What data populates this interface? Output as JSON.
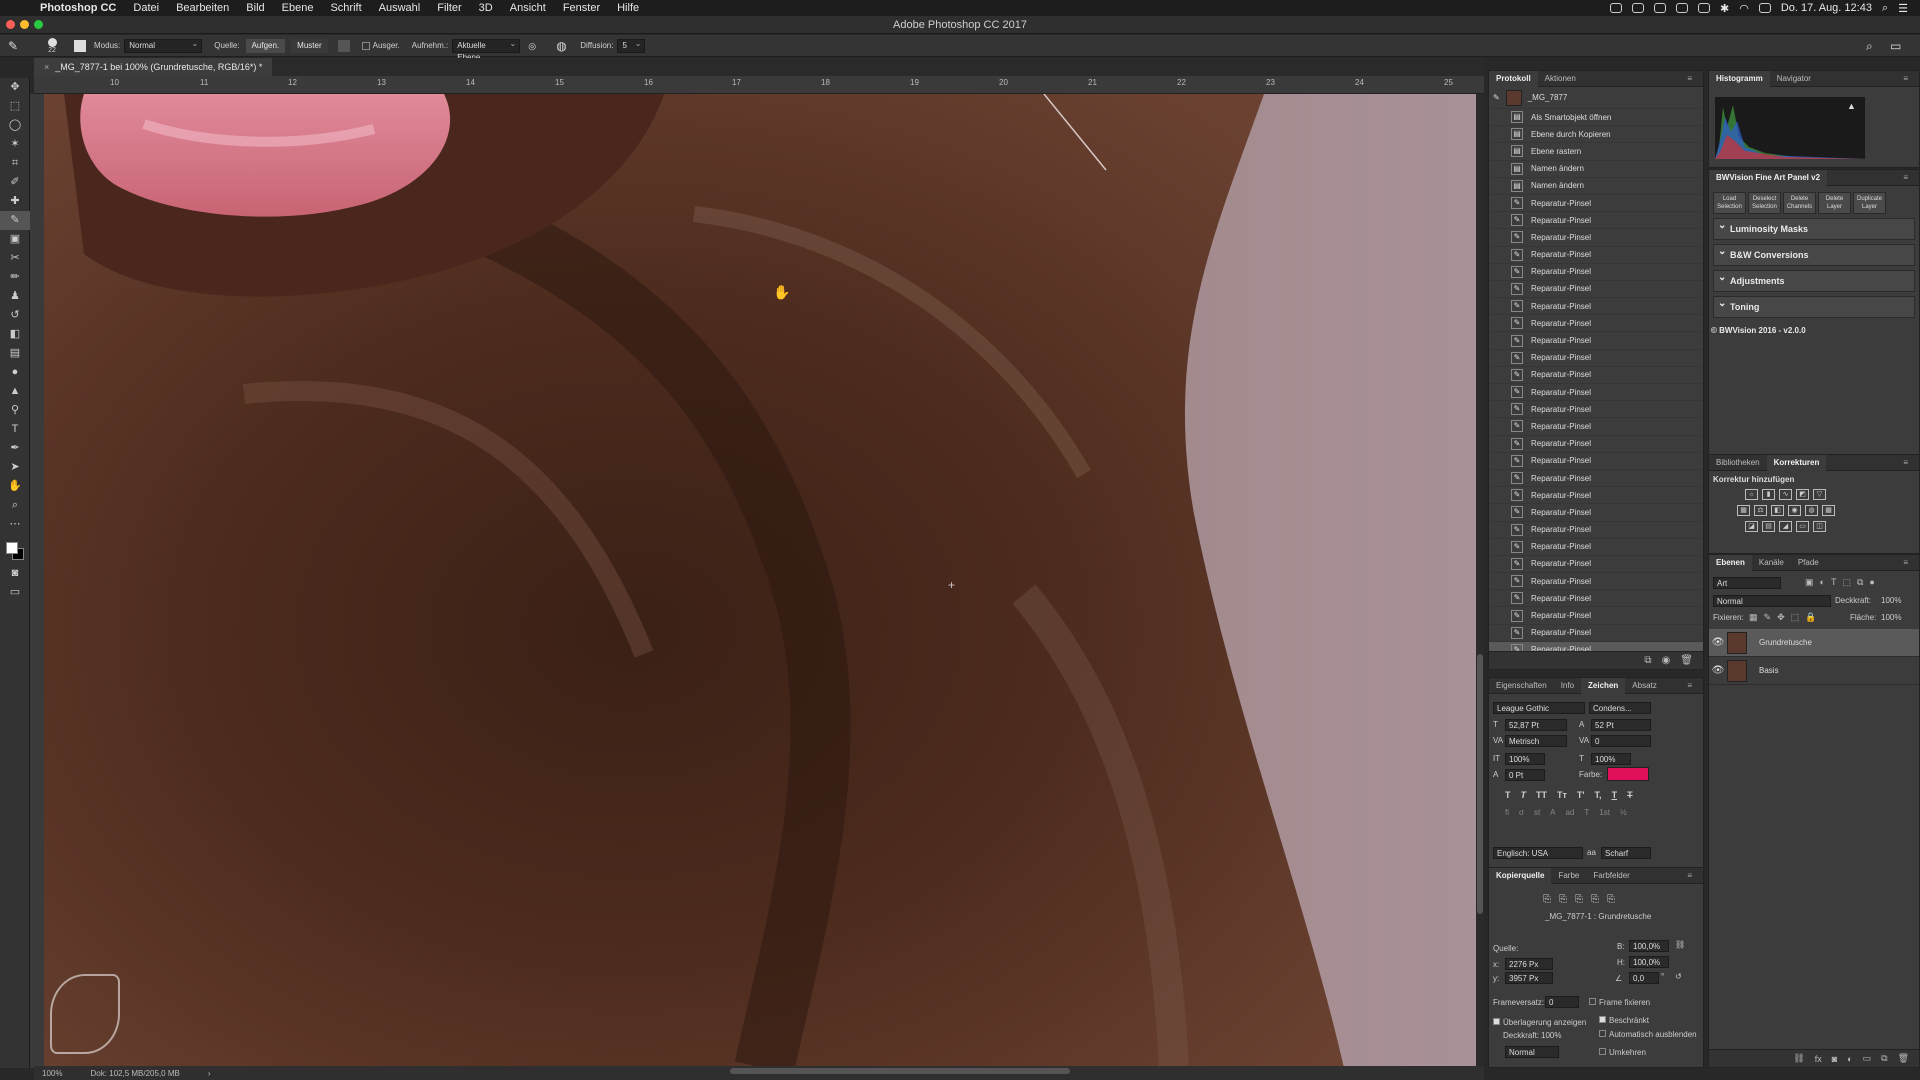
{
  "menubar": {
    "app": "Photoshop CC",
    "items": [
      "Datei",
      "Bearbeiten",
      "Bild",
      "Ebene",
      "Schrift",
      "Auswahl",
      "Filter",
      "3D",
      "Ansicht",
      "Fenster",
      "Hilfe"
    ],
    "clock": "Do. 17. Aug. 12:43"
  },
  "window": {
    "title": "Adobe Photoshop CC 2017"
  },
  "options": {
    "brush_size": "22",
    "modus_label": "Modus:",
    "modus_value": "Normal",
    "quelle_label": "Quelle:",
    "aufgen_label": "Aufgen.",
    "muster_label": "Muster",
    "ausger_label": "Ausger.",
    "aufnehm_label": "Aufnehm.:",
    "aufnehm_value": "Aktuelle Ebene",
    "diffusion_label": "Diffusion:",
    "diffusion_value": "5"
  },
  "document": {
    "tab": "_MG_7877-1 bei 100% (Grundretusche, RGB/16*) *",
    "zoom": "100%",
    "doc_info": "Dok: 102,5 MB/205,0 MB"
  },
  "ruler": {
    "ticks": [
      "10",
      "11",
      "12",
      "13",
      "14",
      "15",
      "16",
      "17",
      "18",
      "19",
      "20",
      "21",
      "22",
      "23",
      "24",
      "25"
    ]
  },
  "tools": [
    "move",
    "marquee",
    "lasso",
    "magic-wand",
    "crop",
    "eyedropper",
    "healing",
    "brush",
    "stamp",
    "history-brush",
    "eraser",
    "gradient",
    "blur",
    "dodge",
    "pen",
    "type",
    "path-select",
    "shape",
    "hand",
    "zoom",
    "more"
  ],
  "history": {
    "tabs": [
      "Protokoll",
      "Aktionen"
    ],
    "snapshot": "_MG_7877",
    "items": [
      "Als Smartobjekt öffnen",
      "Ebene durch Kopieren",
      "Ebene rastern",
      "Namen ändern",
      "Namen ändern",
      "Reparatur-Pinsel",
      "Reparatur-Pinsel",
      "Reparatur-Pinsel",
      "Reparatur-Pinsel",
      "Reparatur-Pinsel",
      "Reparatur-Pinsel",
      "Reparatur-Pinsel",
      "Reparatur-Pinsel",
      "Reparatur-Pinsel",
      "Reparatur-Pinsel",
      "Reparatur-Pinsel",
      "Reparatur-Pinsel",
      "Reparatur-Pinsel",
      "Reparatur-Pinsel",
      "Reparatur-Pinsel",
      "Reparatur-Pinsel",
      "Reparatur-Pinsel",
      "Reparatur-Pinsel",
      "Reparatur-Pinsel",
      "Reparatur-Pinsel",
      "Reparatur-Pinsel",
      "Reparatur-Pinsel",
      "Reparatur-Pinsel",
      "Reparatur-Pinsel",
      "Reparatur-Pinsel",
      "Reparatur-Pinsel",
      "Reparatur-Pinsel"
    ]
  },
  "character": {
    "tabs": [
      "Eigenschaften",
      "Info",
      "Zeichen",
      "Absatz"
    ],
    "font": "League Gothic",
    "style": "Condens...",
    "size": "52,87 Pt",
    "leading": "52 Pt",
    "kerning": "Metrisch",
    "tracking": "0",
    "vscale": "100%",
    "hscale": "100%",
    "baseline": "0 Pt",
    "farbe_label": "Farbe:",
    "farbe": "#e0105a",
    "style_buttons": [
      "T",
      "T",
      "TT",
      "Tт",
      "T'",
      "T,",
      "T",
      "T"
    ],
    "ot_buttons": [
      "fi",
      "σ",
      "st",
      "A",
      "ad",
      "T",
      "1st",
      "½"
    ],
    "language": "Englisch: USA",
    "aa_label": "aa",
    "aa": "Scharf"
  },
  "clone": {
    "tabs": [
      "Kopierquelle",
      "Farbe",
      "Farbfelder"
    ],
    "source_name": "_MG_7877-1 : Grundretusche",
    "quelle_label": "Quelle:",
    "x": "2276 Px",
    "y": "3957 Px",
    "w": "100,0%",
    "h": "100,0%",
    "angle": "0,0",
    "angle_unit": "°",
    "frame_label": "Frameversatz:",
    "frame_value": "0",
    "frame_fix": "Frame fixieren",
    "overlay": "Überlagerung anzeigen",
    "beschrankt": "Beschränkt",
    "auto_hide": "Automatisch ausblenden",
    "deckkraft_label": "Deckkraft:",
    "deckkraft": "100%",
    "mode": "Normal",
    "umkehren": "Umkehren"
  },
  "histogram": {
    "tabs": [
      "Histogramm",
      "Navigator"
    ]
  },
  "bwvision": {
    "title": "BWVision Fine Art Panel v2",
    "buttons": [
      "Load Selection",
      "Deselect Selection",
      "Delete Channels",
      "Delete Layer",
      "Duplicate Layer"
    ],
    "sections": [
      "Luminosity Masks",
      "B&W Conversions",
      "Adjustments",
      "Toning"
    ],
    "footer": "© BWVision 2016 - v2.0.0"
  },
  "adjustments": {
    "tabs": [
      "Bibliotheken",
      "Korrekturen"
    ],
    "title": "Korrektur hinzufügen"
  },
  "layers": {
    "tabs": [
      "Ebenen",
      "Kanäle",
      "Pfade"
    ],
    "filter": "Art",
    "blend": "Normal",
    "opacity_label": "Deckkraft:",
    "opacity": "100%",
    "fix_label": "Fixieren:",
    "fill_label": "Fläche:",
    "fill": "100%",
    "items": [
      {
        "name": "Grundretusche",
        "selected": true
      },
      {
        "name": "Basis",
        "selected": false
      }
    ]
  }
}
